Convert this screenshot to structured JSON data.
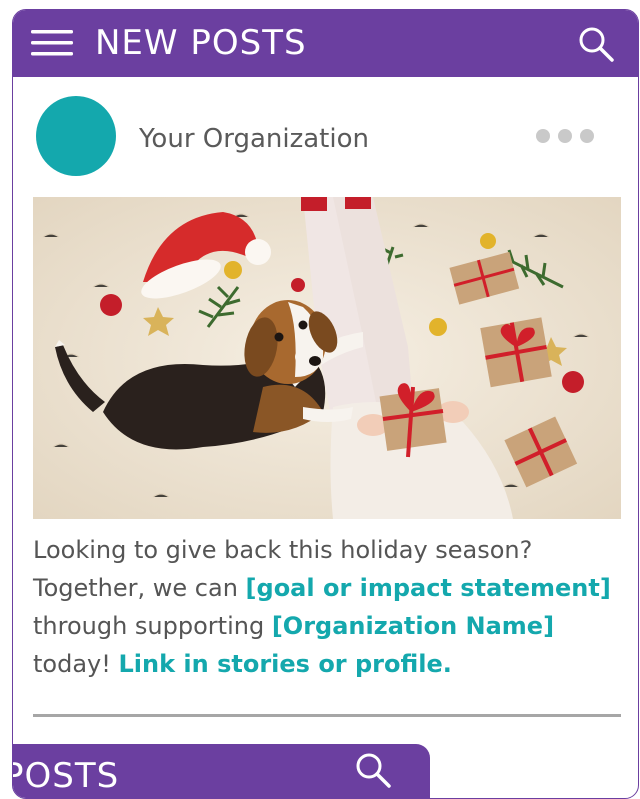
{
  "app_bar": {
    "title": "NEW POSTS",
    "menu_icon": "hamburger-menu-icon",
    "search_icon": "search-icon",
    "color": "#6b3fa0"
  },
  "post": {
    "author": "Your Organization",
    "avatar_color": "#14a8ad",
    "more_icon": "more-options-icon",
    "image_description_icon": "holiday-dog-photo",
    "caption_parts": [
      {
        "text": "Looking to give back this holiday season? Together, we can ",
        "highlight": false
      },
      {
        "text": "[goal or impact statement]",
        "highlight": true
      },
      {
        "text": " through supporting ",
        "highlight": false
      },
      {
        "text": "[Organization Name]",
        "highlight": true
      },
      {
        "text": " today! ",
        "highlight": false
      },
      {
        "text": "Link in stories or profile.",
        "highlight": true
      }
    ],
    "highlight_color": "#14a8ad"
  },
  "next_app_bar": {
    "title": "POSTS",
    "search_icon": "search-icon"
  }
}
